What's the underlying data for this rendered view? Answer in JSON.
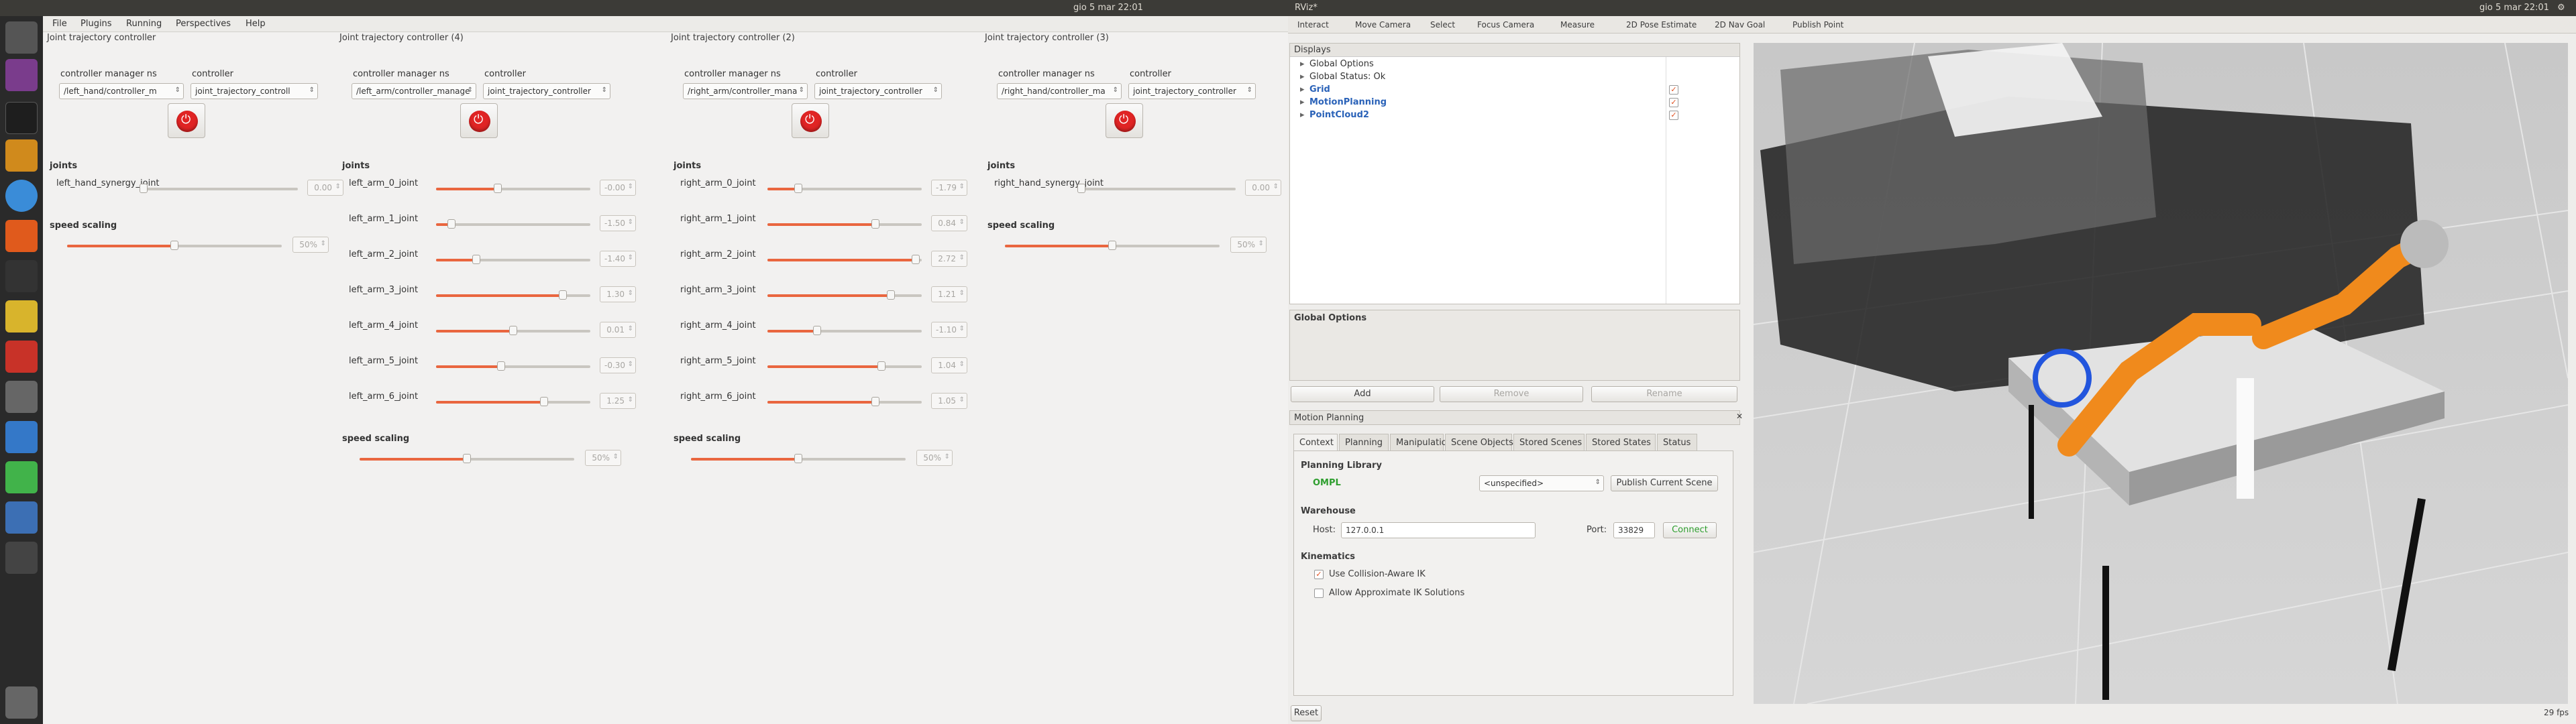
{
  "topbar": {
    "app_title": "RViz*",
    "clock_left": "gio 5 mar 22:01",
    "clock_right": "gio 5 mar 22:01"
  },
  "menu": [
    "File",
    "Plugins",
    "Running",
    "Perspectives",
    "Help"
  ],
  "panels": [
    {
      "title": "Joint trajectory controller",
      "ns_label": "controller manager ns",
      "ctrl_label": "controller",
      "ns_value": "/left_hand/controller_m",
      "ctrl_value": "joint_trajectory_controll",
      "joints_label": "joints",
      "joints": [
        {
          "name": "left_hand_synergy_joint",
          "value": "0.00",
          "pct": 0
        }
      ],
      "speed_label": "speed scaling",
      "speed_value": "50%",
      "speed_pct": 0.5
    },
    {
      "title": "Joint trajectory controller (4)",
      "ns_label": "controller manager ns",
      "ctrl_label": "controller",
      "ns_value": "/left_arm/controller_manage",
      "ctrl_value": "joint_trajectory_controller",
      "joints_label": "joints",
      "joints": [
        {
          "name": "left_arm_0_joint",
          "value": "-0.00",
          "pct": 0.4
        },
        {
          "name": "left_arm_1_joint",
          "value": "-1.50",
          "pct": 0.1
        },
        {
          "name": "left_arm_2_joint",
          "value": "-1.40",
          "pct": 0.26
        },
        {
          "name": "left_arm_3_joint",
          "value": "1.30",
          "pct": 0.82
        },
        {
          "name": "left_arm_4_joint",
          "value": "0.01",
          "pct": 0.5
        },
        {
          "name": "left_arm_5_joint",
          "value": "-0.30",
          "pct": 0.42
        },
        {
          "name": "left_arm_6_joint",
          "value": "1.25",
          "pct": 0.7
        }
      ],
      "speed_label": "speed scaling",
      "speed_value": "50%",
      "speed_pct": 0.5
    },
    {
      "title": "Joint trajectory controller (2)",
      "ns_label": "controller manager ns",
      "ctrl_label": "controller",
      "ns_value": "/right_arm/controller_mana",
      "ctrl_value": "joint_trajectory_controller",
      "joints_label": "joints",
      "joints": [
        {
          "name": "right_arm_0_joint",
          "value": "-1.79",
          "pct": 0.2
        },
        {
          "name": "right_arm_1_joint",
          "value": "0.84",
          "pct": 0.7
        },
        {
          "name": "right_arm_2_joint",
          "value": "2.72",
          "pct": 0.96
        },
        {
          "name": "right_arm_3_joint",
          "value": "1.21",
          "pct": 0.8
        },
        {
          "name": "right_arm_4_joint",
          "value": "-1.10",
          "pct": 0.32
        },
        {
          "name": "right_arm_5_joint",
          "value": "1.04",
          "pct": 0.74
        },
        {
          "name": "right_arm_6_joint",
          "value": "1.05",
          "pct": 0.7
        }
      ],
      "speed_label": "speed scaling",
      "speed_value": "50%",
      "speed_pct": 0.5
    },
    {
      "title": "Joint trajectory controller (3)",
      "ns_label": "controller manager ns",
      "ctrl_label": "controller",
      "ns_value": "/right_hand/controller_ma",
      "ctrl_value": "joint_trajectory_controller",
      "joints_label": "joints",
      "joints": [
        {
          "name": "right_hand_synergy_joint",
          "value": "0.00",
          "pct": 0
        }
      ],
      "speed_label": "speed scaling",
      "speed_value": "50%",
      "speed_pct": 0.5
    }
  ],
  "rviz": {
    "toolbar": [
      "Interact",
      "Move Camera",
      "Select",
      "Focus Camera",
      "Measure",
      "2D Pose Estimate",
      "2D Nav Goal",
      "Publish Point"
    ],
    "displays_title": "Displays",
    "displays": [
      {
        "label": "Global Options",
        "checked": false
      },
      {
        "label": "Global Status: Ok",
        "checked": false
      },
      {
        "label": "Grid",
        "checked": true
      },
      {
        "label": "MotionPlanning",
        "checked": true
      },
      {
        "label": "PointCloud2",
        "checked": true
      }
    ],
    "desc_title": "Global Options",
    "buttons": {
      "add": "Add",
      "remove": "Remove",
      "rename": "Rename"
    },
    "mp_title": "Motion Planning",
    "tabs": [
      "Context",
      "Planning",
      "Manipulation",
      "Scene Objects",
      "Stored Scenes",
      "Stored States",
      "Status"
    ],
    "planning_library": "Planning Library",
    "ompl": "OMPL",
    "planner": "<unspecified>",
    "publish_scene": "Publish Current Scene",
    "warehouse": "Warehouse",
    "host_label": "Host:",
    "host": "127.0.0.1",
    "port_label": "Port:",
    "port": "33829",
    "connect": "Connect",
    "kinematics": "Kinematics",
    "collision_ik": "Use Collision-Aware IK",
    "approx_ik": "Allow Approximate IK Solutions",
    "reset": "Reset",
    "fps": "29 fps"
  },
  "colors": {
    "accent": "#e9663f",
    "power": "#e02424",
    "ompl": "#2e9e2e",
    "robot": "#f08a1c"
  }
}
